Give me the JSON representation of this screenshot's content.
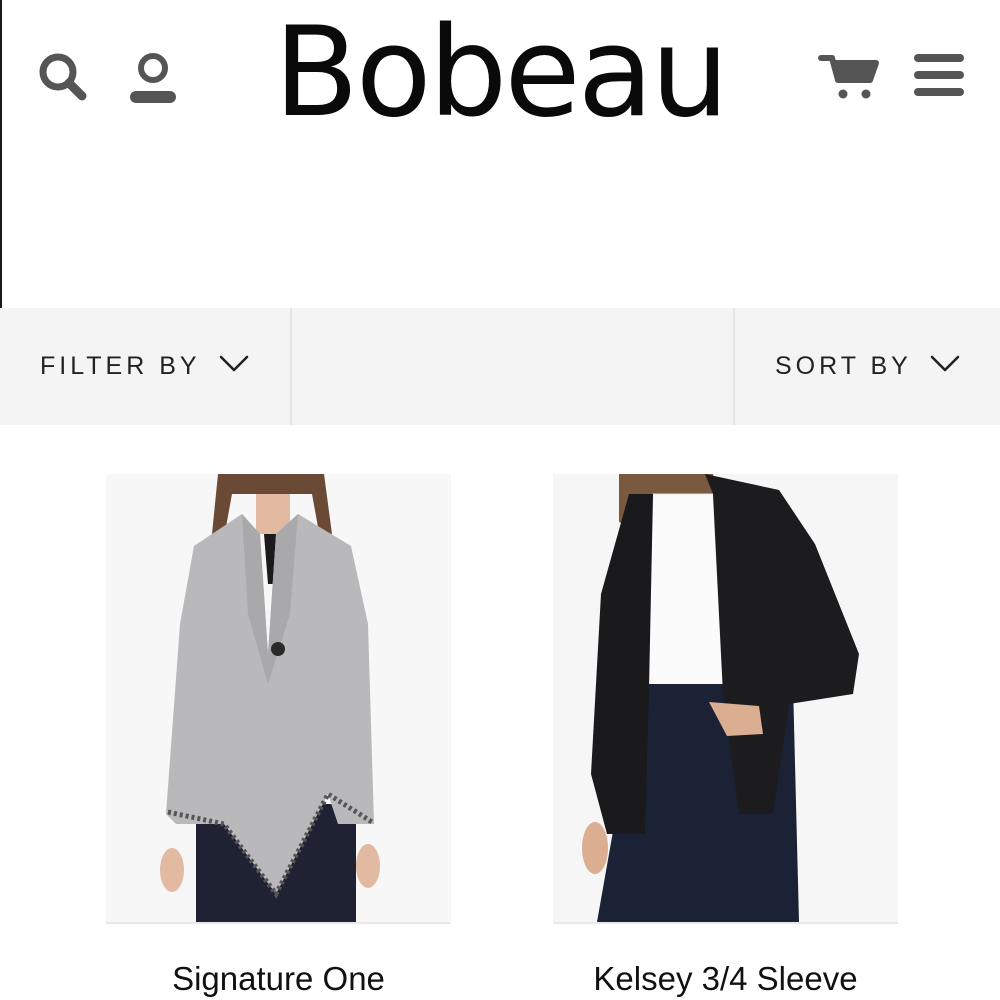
{
  "brand": {
    "logo_text": "Bobeau"
  },
  "header": {
    "icons": [
      "search-icon",
      "account-icon",
      "cart-icon",
      "menu-icon"
    ]
  },
  "toolbar": {
    "filter_label": "FILTER BY",
    "sort_label": "SORT BY"
  },
  "products": [
    {
      "name": "Signature One",
      "image": "model-gray-cardigan"
    },
    {
      "name": "Kelsey 3/4 Sleeve",
      "image": "model-black-cardigan"
    }
  ],
  "colors": {
    "icon": "#555555",
    "bar_background": "#f4f4f4",
    "text": "#111111"
  }
}
